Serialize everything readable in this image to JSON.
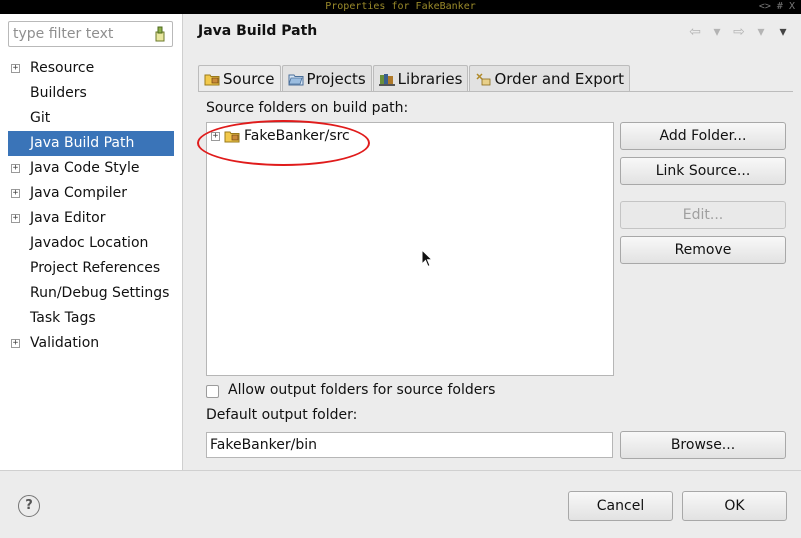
{
  "titlebar": {
    "title": "Properties for FakeBanker",
    "controls": "<> # X"
  },
  "filter": {
    "placeholder": "type filter text"
  },
  "sidebar": {
    "items": [
      {
        "label": "Resource",
        "expandable": true
      },
      {
        "label": "Builders",
        "expandable": false
      },
      {
        "label": "Git",
        "expandable": false
      },
      {
        "label": "Java Build Path",
        "expandable": false,
        "selected": true
      },
      {
        "label": "Java Code Style",
        "expandable": true
      },
      {
        "label": "Java Compiler",
        "expandable": true
      },
      {
        "label": "Java Editor",
        "expandable": true
      },
      {
        "label": "Javadoc Location",
        "expandable": false
      },
      {
        "label": "Project References",
        "expandable": false
      },
      {
        "label": "Run/Debug Settings",
        "expandable": false
      },
      {
        "label": "Task Tags",
        "expandable": false
      },
      {
        "label": "Validation",
        "expandable": true
      }
    ]
  },
  "page": {
    "title": "Java Build Path"
  },
  "tabs": [
    {
      "label": "Source",
      "icon": "source-folder-icon",
      "active": true
    },
    {
      "label": "Projects",
      "icon": "projects-icon",
      "active": false
    },
    {
      "label": "Libraries",
      "icon": "libraries-icon",
      "active": false
    },
    {
      "label": "Order and Export",
      "icon": "order-export-icon",
      "active": false
    }
  ],
  "source": {
    "list_label": "Source folders on build path:",
    "folders": [
      {
        "label": "FakeBanker/src"
      }
    ],
    "buttons": {
      "add": "Add Folder...",
      "link": "Link Source...",
      "edit": "Edit...",
      "remove": "Remove"
    },
    "allow_output_label": "Allow output folders for source folders",
    "allow_output_checked": false,
    "output_label": "Default output folder:",
    "output_value": "FakeBanker/bin",
    "browse": "Browse..."
  },
  "footer": {
    "help": "?",
    "cancel": "Cancel",
    "ok": "OK"
  },
  "colors": {
    "selection": "#3a74b8",
    "highlight_oval": "#e01b1b"
  }
}
